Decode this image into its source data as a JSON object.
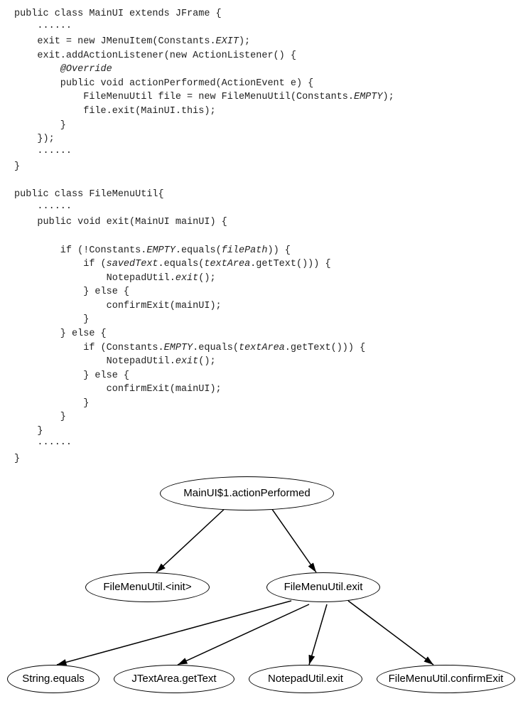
{
  "code": {
    "lines": [
      "public class MainUI extends JFrame {",
      "    ······",
      "    exit = new JMenuItem(Constants.EXIT);",
      "    exit.addActionListener(new ActionListener() {",
      "        @Override",
      "        public void actionPerformed(ActionEvent e) {",
      "            FileMenuUtil file = new FileMenuUtil(Constants.EMPTY);",
      "            file.exit(MainUI.this);",
      "        }",
      "    });",
      "    ······",
      "}",
      "",
      "public class FileMenuUtil{",
      "    ······",
      "    public void exit(MainUI mainUI) {",
      "",
      "        if (!Constants.EMPTY.equals(filePath)) {",
      "            if (savedText.equals(textArea.getText())) {",
      "                NotepadUtil.exit();",
      "            } else {",
      "                confirmExit(mainUI);",
      "            }",
      "        } else {",
      "            if (Constants.EMPTY.equals(textArea.getText())) {",
      "                NotepadUtil.exit();",
      "            } else {",
      "                confirmExit(mainUI);",
      "            }",
      "        }",
      "    }",
      "    ······",
      "}"
    ]
  },
  "diagram": {
    "nodes": {
      "root": "MainUI$1.actionPerformed",
      "left_mid": "FileMenuUtil.<init>",
      "right_mid": "FileMenuUtil.exit",
      "leaf1": "String.equals",
      "leaf2": "JTextArea.getText",
      "leaf3": "NotepadUtil.exit",
      "leaf4": "FileMenuUtil.confirmExit"
    },
    "edges": [
      [
        "root",
        "left_mid"
      ],
      [
        "root",
        "right_mid"
      ],
      [
        "right_mid",
        "leaf1"
      ],
      [
        "right_mid",
        "leaf2"
      ],
      [
        "right_mid",
        "leaf3"
      ],
      [
        "right_mid",
        "leaf4"
      ]
    ]
  }
}
